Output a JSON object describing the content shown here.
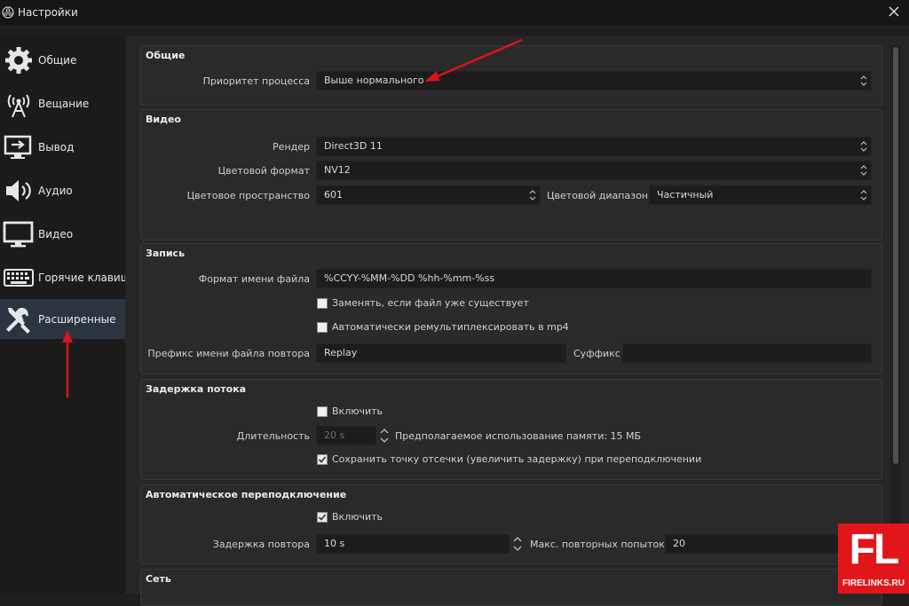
{
  "window": {
    "title": "Настройки"
  },
  "sidebar": {
    "items": [
      {
        "label": "Общие",
        "icon": "gear-icon"
      },
      {
        "label": "Вещание",
        "icon": "antenna-icon"
      },
      {
        "label": "Вывод",
        "icon": "output-icon"
      },
      {
        "label": "Аудио",
        "icon": "speaker-icon"
      },
      {
        "label": "Видео",
        "icon": "monitor-icon"
      },
      {
        "label": "Горячие клавиши",
        "icon": "keyboard-icon"
      },
      {
        "label": "Расширенные",
        "icon": "tools-icon",
        "active": true
      }
    ]
  },
  "general": {
    "title": "Общие",
    "priority_label": "Приоритет процесса",
    "priority_value": "Выше нормального"
  },
  "video": {
    "title": "Видео",
    "renderer_label": "Рендер",
    "renderer_value": "Direct3D 11",
    "color_format_label": "Цветовой формат",
    "color_format_value": "NV12",
    "color_space_label": "Цветовое пространство",
    "color_space_value": "601",
    "color_range_label": "Цветовой диапазон",
    "color_range_value": "Частичный"
  },
  "recording": {
    "title": "Запись",
    "filename_format_label": "Формат имени файла",
    "filename_format_value": "%CCYY-%MM-%DD %hh-%mm-%ss",
    "overwrite_label": "Заменять, если файл уже существует",
    "overwrite_checked": false,
    "remux_label": "Автоматически ремультиплексировать в mp4",
    "remux_checked": false,
    "replay_prefix_label": "Префикс имени файла повтора",
    "replay_prefix_value": "Replay",
    "suffix_label": "Суффикс",
    "suffix_value": ""
  },
  "stream_delay": {
    "title": "Задержка потока",
    "enable_label": "Включить",
    "enable_checked": false,
    "duration_label": "Длительность",
    "duration_value": "20 s",
    "memory_text": "Предполагаемое использование памяти: 15 МБ",
    "preserve_label": "Сохранить точку отсечки (увеличить задержку) при переподключении",
    "preserve_checked": true
  },
  "reconnect": {
    "title": "Автоматическое переподключение",
    "enable_label": "Включить",
    "enable_checked": true,
    "retry_delay_label": "Задержка повтора",
    "retry_delay_value": "10 s",
    "max_retries_label": "Макс. повторных попыток",
    "max_retries_value": "20"
  },
  "network": {
    "title": "Сеть"
  },
  "watermark": {
    "big": "FL",
    "small": "FIRELINKS.RU"
  },
  "colors": {
    "annotation_arrow": "#d9141b",
    "sidebar_active": "#2b3540"
  }
}
